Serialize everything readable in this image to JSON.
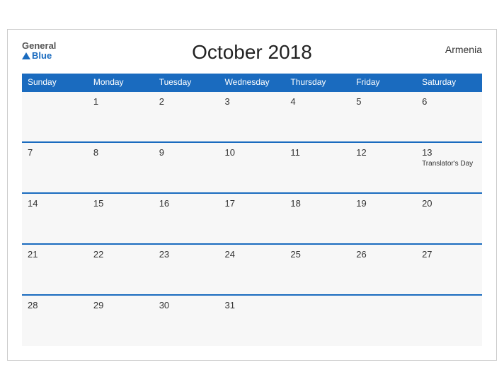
{
  "header": {
    "title": "October 2018",
    "country": "Armenia",
    "logo_general": "General",
    "logo_blue": "Blue"
  },
  "weekdays": [
    "Sunday",
    "Monday",
    "Tuesday",
    "Wednesday",
    "Thursday",
    "Friday",
    "Saturday"
  ],
  "weeks": [
    [
      {
        "day": "",
        "holiday": ""
      },
      {
        "day": "1",
        "holiday": ""
      },
      {
        "day": "2",
        "holiday": ""
      },
      {
        "day": "3",
        "holiday": ""
      },
      {
        "day": "4",
        "holiday": ""
      },
      {
        "day": "5",
        "holiday": ""
      },
      {
        "day": "6",
        "holiday": ""
      }
    ],
    [
      {
        "day": "7",
        "holiday": ""
      },
      {
        "day": "8",
        "holiday": ""
      },
      {
        "day": "9",
        "holiday": ""
      },
      {
        "day": "10",
        "holiday": ""
      },
      {
        "day": "11",
        "holiday": ""
      },
      {
        "day": "12",
        "holiday": ""
      },
      {
        "day": "13",
        "holiday": "Translator's Day"
      }
    ],
    [
      {
        "day": "14",
        "holiday": ""
      },
      {
        "day": "15",
        "holiday": ""
      },
      {
        "day": "16",
        "holiday": ""
      },
      {
        "day": "17",
        "holiday": ""
      },
      {
        "day": "18",
        "holiday": ""
      },
      {
        "day": "19",
        "holiday": ""
      },
      {
        "day": "20",
        "holiday": ""
      }
    ],
    [
      {
        "day": "21",
        "holiday": ""
      },
      {
        "day": "22",
        "holiday": ""
      },
      {
        "day": "23",
        "holiday": ""
      },
      {
        "day": "24",
        "holiday": ""
      },
      {
        "day": "25",
        "holiday": ""
      },
      {
        "day": "26",
        "holiday": ""
      },
      {
        "day": "27",
        "holiday": ""
      }
    ],
    [
      {
        "day": "28",
        "holiday": ""
      },
      {
        "day": "29",
        "holiday": ""
      },
      {
        "day": "30",
        "holiday": ""
      },
      {
        "day": "31",
        "holiday": ""
      },
      {
        "day": "",
        "holiday": ""
      },
      {
        "day": "",
        "holiday": ""
      },
      {
        "day": "",
        "holiday": ""
      }
    ]
  ]
}
